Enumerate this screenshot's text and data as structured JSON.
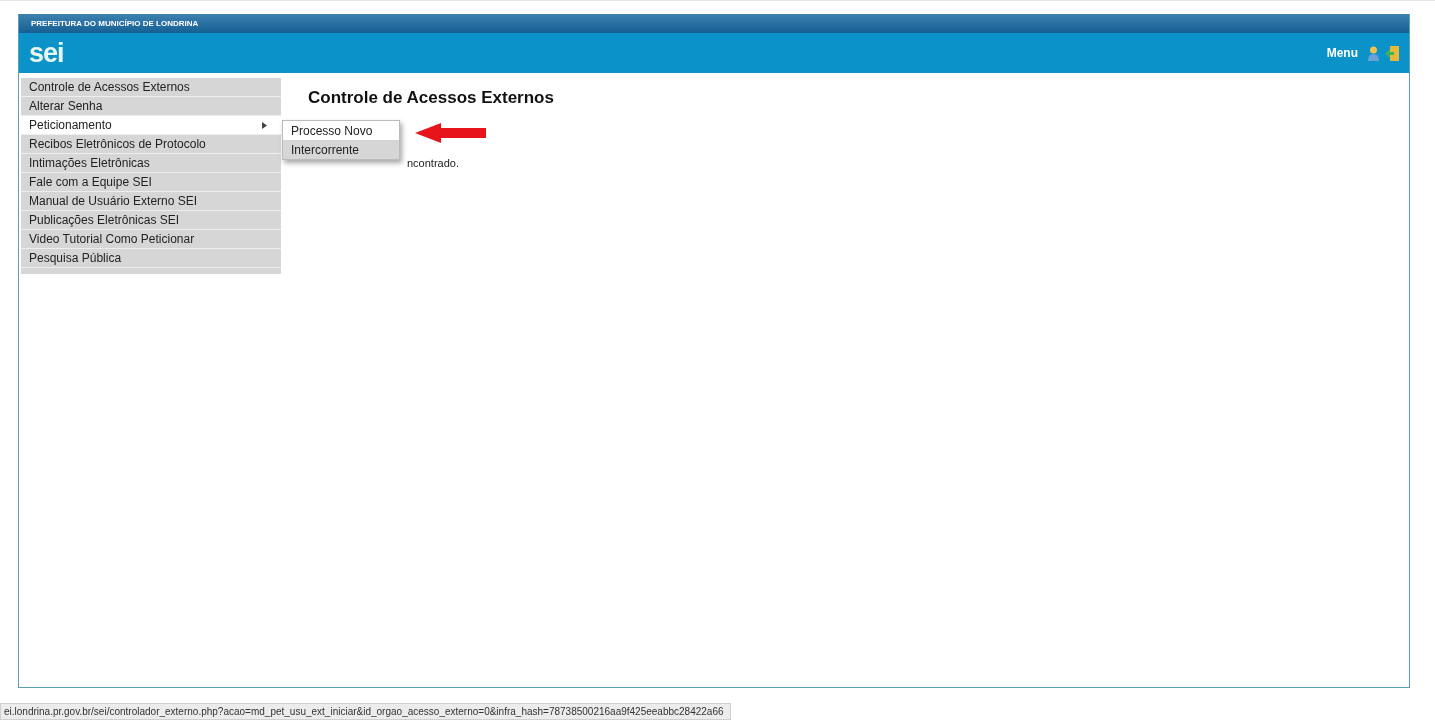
{
  "header": {
    "org": "PREFEITURA DO MUNICÍPIO DE LONDRINA",
    "logo": "sei",
    "menu": "Menu"
  },
  "sidebar": {
    "items": [
      {
        "label": "Controle de Acessos Externos",
        "selected": false,
        "submenu": false
      },
      {
        "label": "Alterar Senha",
        "selected": false,
        "submenu": false
      },
      {
        "label": "Peticionamento",
        "selected": true,
        "submenu": true
      },
      {
        "label": "Recibos Eletrônicos de Protocolo",
        "selected": false,
        "submenu": false
      },
      {
        "label": "Intimações Eletrônicas",
        "selected": false,
        "submenu": false
      },
      {
        "label": "Fale com a Equipe SEI",
        "selected": false,
        "submenu": false
      },
      {
        "label": "Manual de Usuário Externo SEI",
        "selected": false,
        "submenu": false
      },
      {
        "label": "Publicações Eletrônicas SEI",
        "selected": false,
        "submenu": false
      },
      {
        "label": "Video Tutorial Como Peticionar",
        "selected": false,
        "submenu": false
      },
      {
        "label": "Pesquisa Pública",
        "selected": false,
        "submenu": false
      }
    ]
  },
  "submenu": {
    "items": [
      {
        "label": "Processo Novo",
        "selected": true
      },
      {
        "label": "Intercorrente",
        "selected": false
      }
    ]
  },
  "content": {
    "title": "Controle de Acessos Externos",
    "message": "ncontrado."
  },
  "status_bar": {
    "url": "ei.londrina.pr.gov.br/sei/controlador_externo.php?acao=md_pet_usu_ext_iniciar&id_orgao_acesso_externo=0&infra_hash=78738500216aa9f425eeabbc28422a66"
  }
}
